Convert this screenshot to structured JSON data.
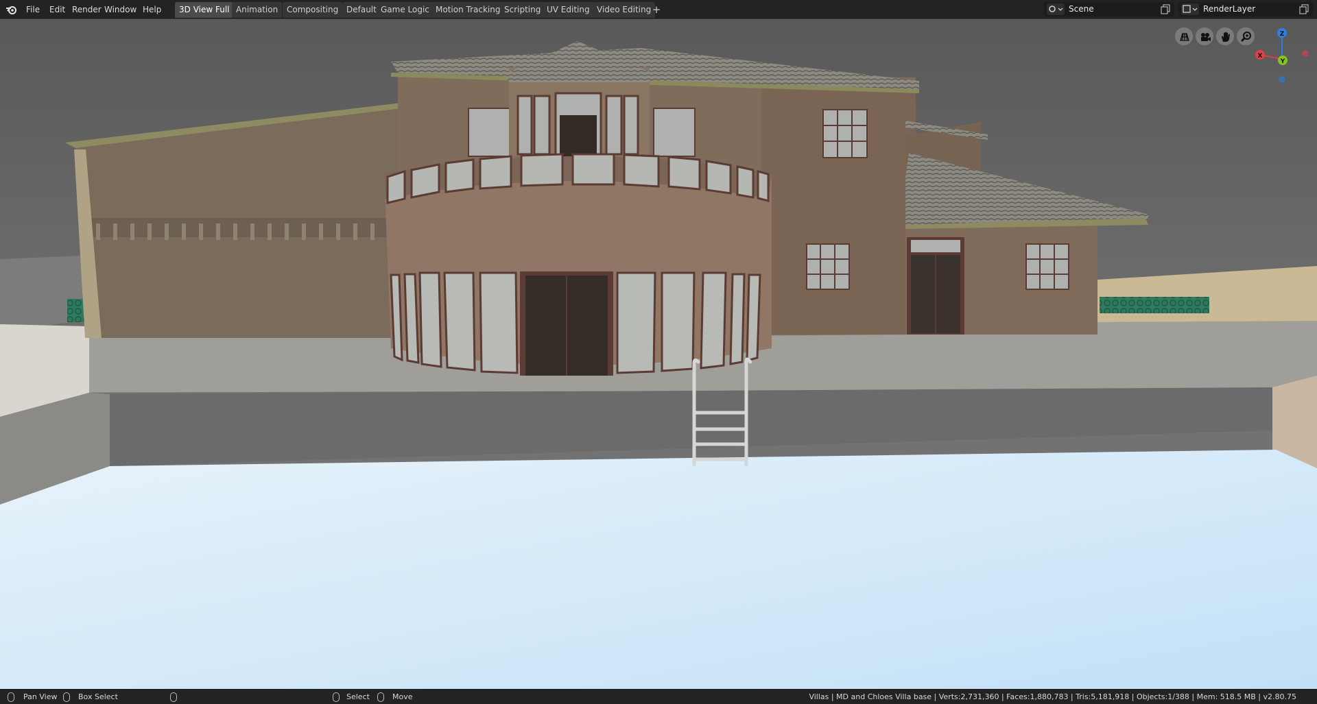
{
  "menu": {
    "items": [
      "File",
      "Edit",
      "Render",
      "Window",
      "Help"
    ]
  },
  "workspaces": {
    "tabs": [
      "3D View Full",
      "Animation",
      "Compositing",
      "Default",
      "Game Logic",
      "Motion Tracking",
      "Scripting",
      "UV Editing",
      "Video Editing"
    ],
    "active_index": 0,
    "add_label": "+"
  },
  "scene_selector": {
    "value": "Scene",
    "icon": "scene-icon"
  },
  "layer_selector": {
    "value": "RenderLayer",
    "icon": "render-layer-icon"
  },
  "viewport_nav": {
    "icons": [
      "perspective-grid-icon",
      "camera-icon",
      "pan-hand-icon",
      "zoom-icon"
    ]
  },
  "gizmo": {
    "x_label": "X",
    "y_label": "Y",
    "z_label": "Z"
  },
  "colors": {
    "axis_x": "#e23d4b",
    "axis_y": "#84c41c",
    "axis_z": "#2f7fe0",
    "topbar_bg": "#232323",
    "active_tab": "#4b4b4b"
  },
  "statusbar": {
    "pan_view": "Pan View",
    "box_select": "Box Select",
    "select": "Select",
    "move": "Move",
    "stats": "Villas | MD and Chloes Villa base | Verts:2,731,360 | Faces:1,880,783 | Tris:5,181,918 | Objects:1/388 | Mem: 518.5 MB | v2.80.75"
  }
}
